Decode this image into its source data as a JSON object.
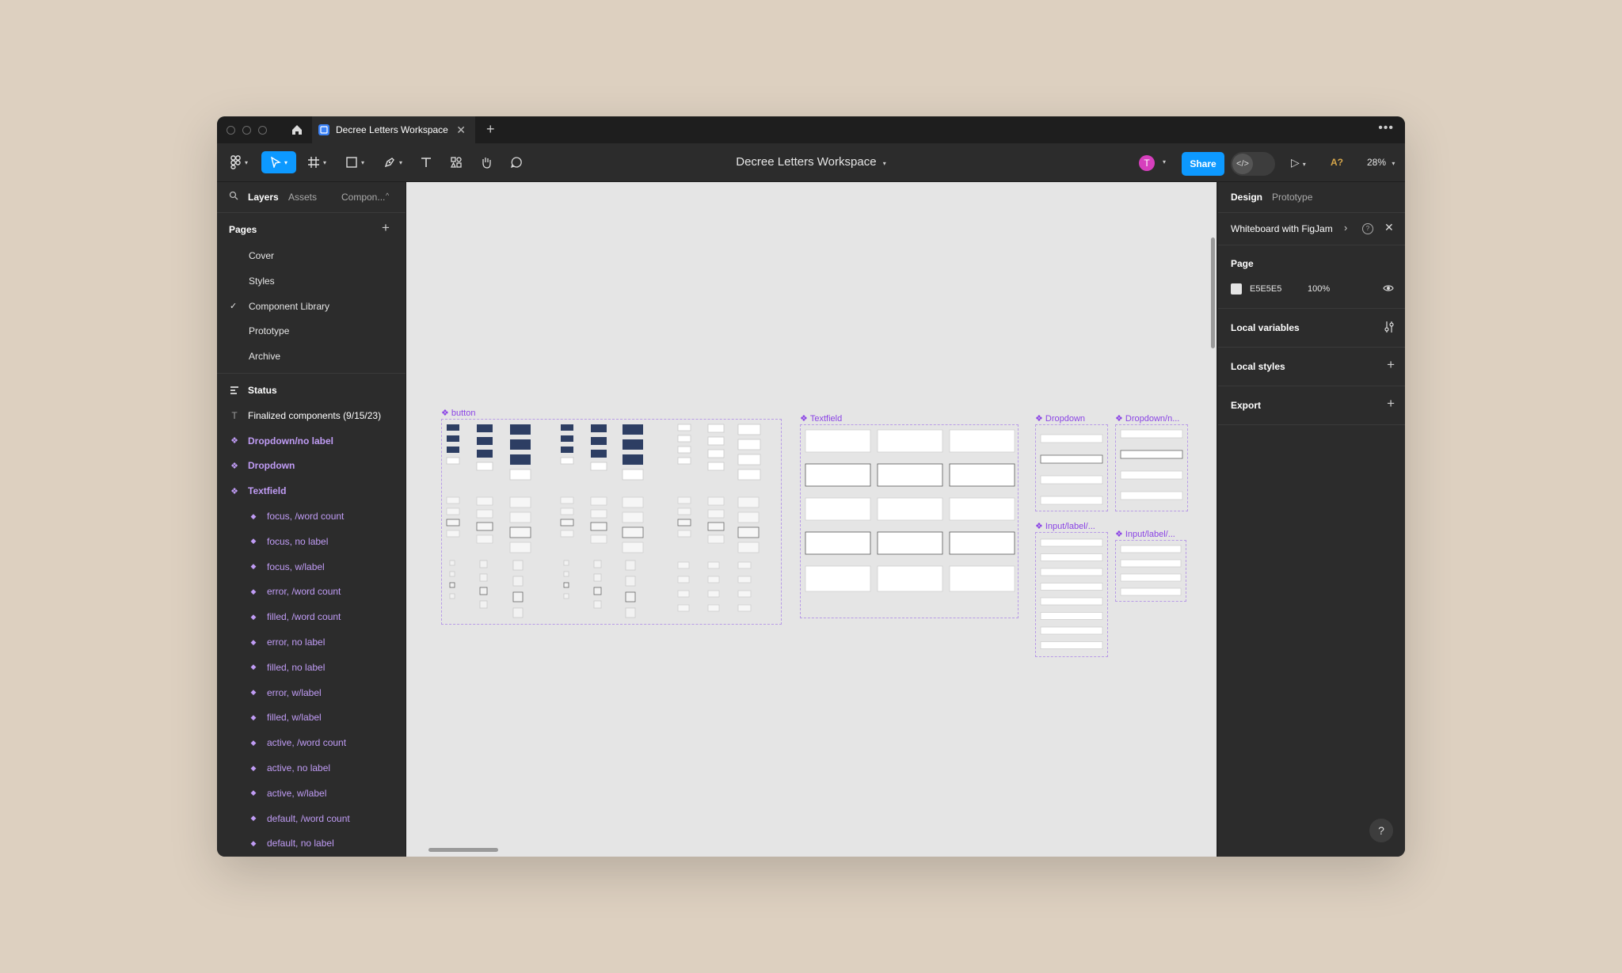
{
  "window": {
    "tab_title": "Decree Letters Workspace",
    "doc_title": "Decree Letters Workspace"
  },
  "toolbar": {
    "share_label": "Share",
    "avatar_initial": "T",
    "a11y_label": "A?",
    "zoom": "28%"
  },
  "left_panel": {
    "tabs": [
      "Layers",
      "Assets",
      "Compon..."
    ],
    "pages_heading": "Pages",
    "pages": [
      "Cover",
      "Styles",
      "Component Library",
      "Prototype",
      "Archive"
    ],
    "current_page": "Component Library",
    "layers": [
      {
        "label": "Status",
        "kind": "section"
      },
      {
        "label": "Finalized components (9/15/23)",
        "kind": "text"
      },
      {
        "label": "Dropdown/no label",
        "kind": "component"
      },
      {
        "label": "Dropdown",
        "kind": "component"
      },
      {
        "label": "Textfield",
        "kind": "component"
      },
      {
        "label": "focus, /word count",
        "kind": "variant"
      },
      {
        "label": "focus, no label",
        "kind": "variant"
      },
      {
        "label": "focus, w/label",
        "kind": "variant"
      },
      {
        "label": "error, /word count",
        "kind": "variant"
      },
      {
        "label": "filled, /word count",
        "kind": "variant"
      },
      {
        "label": "error, no label",
        "kind": "variant"
      },
      {
        "label": "filled, no label",
        "kind": "variant"
      },
      {
        "label": "error, w/label",
        "kind": "variant"
      },
      {
        "label": "filled, w/label",
        "kind": "variant"
      },
      {
        "label": "active, /word count",
        "kind": "variant"
      },
      {
        "label": "active, no label",
        "kind": "variant"
      },
      {
        "label": "active, w/label",
        "kind": "variant"
      },
      {
        "label": "default, /word count",
        "kind": "variant"
      },
      {
        "label": "default, no label",
        "kind": "variant"
      }
    ]
  },
  "canvas": {
    "frames": [
      {
        "label": "button"
      },
      {
        "label": "Textfield"
      },
      {
        "label": "Dropdown"
      },
      {
        "label": "Dropdown/n..."
      },
      {
        "label": "Input/label/..."
      },
      {
        "label": "Input/label/..."
      }
    ]
  },
  "right_panel": {
    "tabs": [
      "Design",
      "Prototype"
    ],
    "banner": "Whiteboard with FigJam",
    "page_heading": "Page",
    "page_color": "E5E5E5",
    "page_opacity": "100%",
    "local_variables": "Local variables",
    "local_styles": "Local styles",
    "export": "Export",
    "help": "?"
  },
  "colors": {
    "accent": "#0d99ff",
    "component": "#c09cf5",
    "canvas": "#e5e5e5",
    "panel": "#2c2c2c"
  }
}
